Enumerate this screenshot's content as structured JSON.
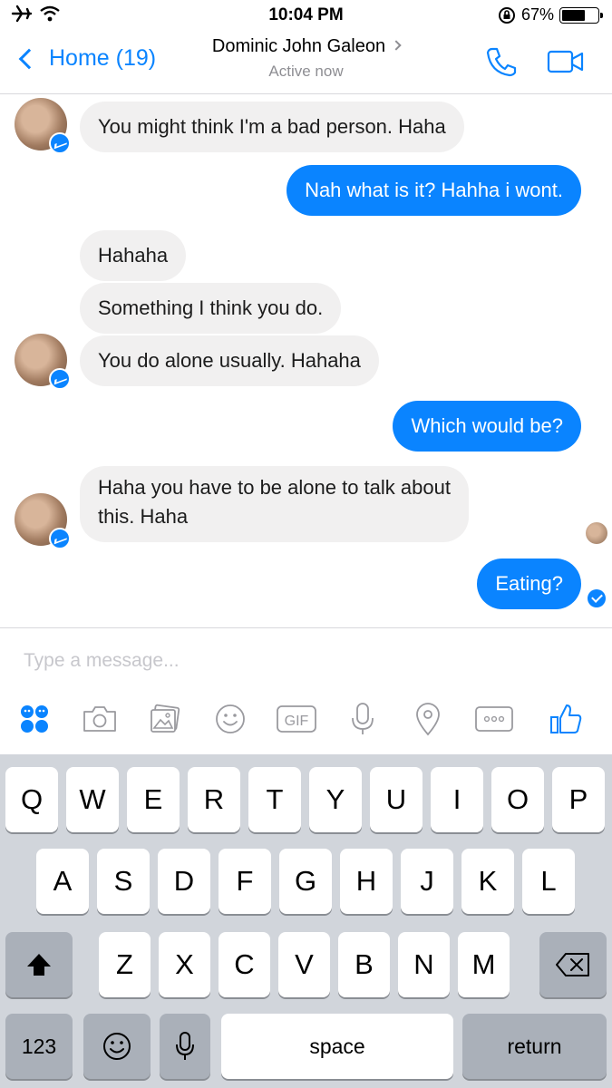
{
  "status_bar": {
    "time": "10:04 PM",
    "battery": "67%",
    "battery_level": 0.67,
    "icons": [
      "airplane-icon",
      "wifi-icon",
      "rotation-lock-icon",
      "battery-icon"
    ]
  },
  "header": {
    "back_label": "Home (19)",
    "contact_name": "Dominic John Galeon",
    "presence": "Active now",
    "icons": [
      "phone-icon",
      "video-call-icon"
    ]
  },
  "messages": [
    {
      "side": "in",
      "text": "You might think I'm a bad person. Haha"
    },
    {
      "side": "out",
      "text": "Nah what is it? Hahha i wont."
    },
    {
      "side": "in",
      "text": "Hahaha"
    },
    {
      "side": "in",
      "text": "Something I think you do."
    },
    {
      "side": "in",
      "text": "You do alone usually. Hahaha"
    },
    {
      "side": "out",
      "text": "Which would be?"
    },
    {
      "side": "in",
      "text_line1": "Haha you have to be alone to talk about",
      "text_line2": "this. Haha"
    },
    {
      "side": "out",
      "text": "Eating?"
    }
  ],
  "composer": {
    "placeholder": "Type a message...",
    "tools": [
      "stickers-icon",
      "camera-icon",
      "gallery-icon",
      "emoji-icon",
      "gif-icon",
      "microphone-icon",
      "location-icon",
      "more-icon",
      "like-icon"
    ],
    "gif_label": "GIF"
  },
  "keyboard": {
    "row1": [
      "Q",
      "W",
      "E",
      "R",
      "T",
      "Y",
      "U",
      "I",
      "O",
      "P"
    ],
    "row2": [
      "A",
      "S",
      "D",
      "F",
      "G",
      "H",
      "J",
      "K",
      "L"
    ],
    "row3": [
      "Z",
      "X",
      "C",
      "V",
      "B",
      "N",
      "M"
    ],
    "numbers_label": "123",
    "space_label": "space",
    "return_label": "return"
  }
}
